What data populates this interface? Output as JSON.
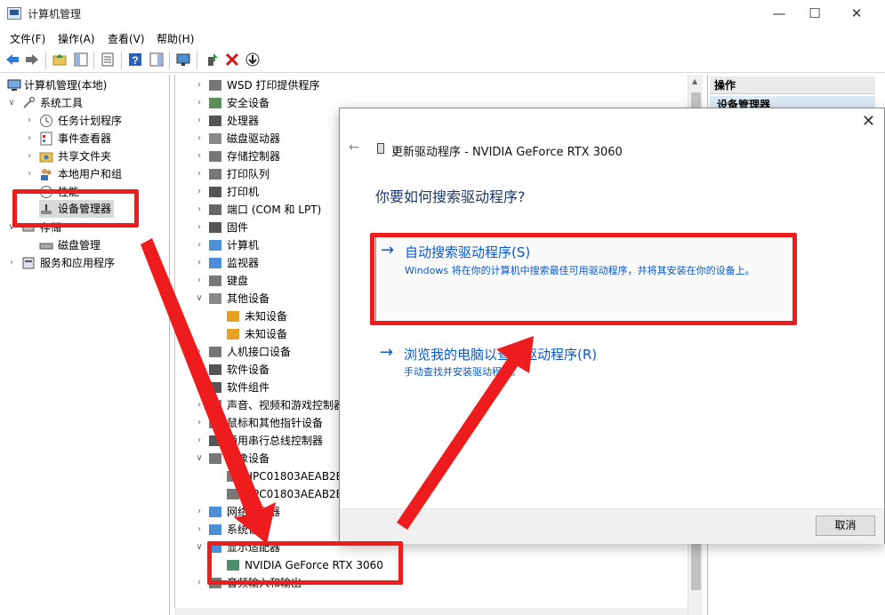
{
  "window": {
    "title": "计算机管理",
    "min": "—",
    "max": "☐",
    "close": "✕"
  },
  "menu": [
    "文件(F)",
    "操作(A)",
    "查看(V)",
    "帮助(H)"
  ],
  "tree": {
    "root": "计算机管理(本地)",
    "system_tools": "系统工具",
    "task_scheduler": "任务计划程序",
    "event_viewer": "事件查看器",
    "shared_folders": "共享文件夹",
    "local_users": "本地用户和组",
    "performance": "性能",
    "device_manager": "设备管理器",
    "storage": "存储",
    "disk_management": "磁盘管理",
    "services": "服务和应用程序"
  },
  "devices": [
    "WSD 打印提供程序",
    "安全设备",
    "处理器",
    "磁盘驱动器",
    "存储控制器",
    "打印队列",
    "打印机",
    "端口 (COM 和 LPT)",
    "固件",
    "计算机",
    "监视器",
    "键盘",
    "其他设备",
    "未知设备",
    "未知设备",
    "人机接口设备",
    "软件设备",
    "软件组件",
    "声音、视频和游戏控制器",
    "鼠标和其他指针设备",
    "通用串行总线控制器",
    "图像设备",
    "HPC01803AEAB2B",
    "HPC01803AEAB2B",
    "网络适配器",
    "系统设备",
    "显示适配器",
    "NVIDIA GeForce RTX 3060",
    "音频输入和输出"
  ],
  "actions": {
    "header": "操作",
    "item": "设备管理器"
  },
  "dialog": {
    "title": "更新驱动程序 - NVIDIA GeForce RTX 3060",
    "question": "你要如何搜索驱动程序?",
    "auto_title": "自动搜索驱动程序(S)",
    "auto_desc": "Windows 将在你的计算机中搜索最佳可用驱动程序，并将其安装在你的设备上。",
    "browse_title": "浏览我的电脑以查找驱动程序(R)",
    "browse_desc": "手动查找并安装驱动程序。",
    "cancel": "取消",
    "close": "✕",
    "back": "←",
    "arrow": "→"
  },
  "colors": {
    "highlight": "#ee1c1c",
    "link": "#0a58ca"
  }
}
